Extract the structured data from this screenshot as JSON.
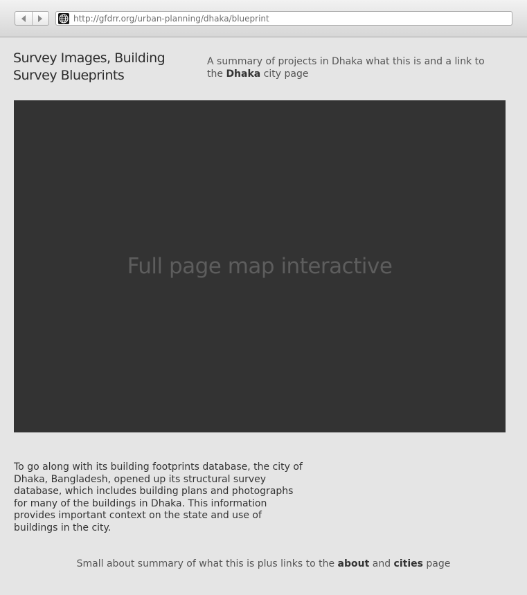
{
  "browser": {
    "url": "http://gfdrr.org/urban-planning/dhaka/blueprint",
    "back_icon": "back-arrow-icon",
    "forward_icon": "forward-arrow-icon",
    "site_icon": "globe-icon"
  },
  "header": {
    "title": "Survey Images, Building Survey Blueprints",
    "intro_text": "A summary of projects in Dhaka what this is and a link to the ",
    "intro_link": "Dhaka",
    "intro_suffix": " city page"
  },
  "map": {
    "placeholder": "Full page map interactive",
    "background_color": "#333333"
  },
  "description": "To go along with its building footprints database, the city of Dhaka, Bangladesh, opened up its structural survey database, which includes building plans and photographs for many of the buildings in Dhaka. This information provides important context on the state and use of buildings in the city.",
  "footer": {
    "text_before": "Small about summary of what this is plus links to the ",
    "about_link": "about",
    "text_middle": " and ",
    "cities_link": "cities",
    "text_after": " page"
  }
}
